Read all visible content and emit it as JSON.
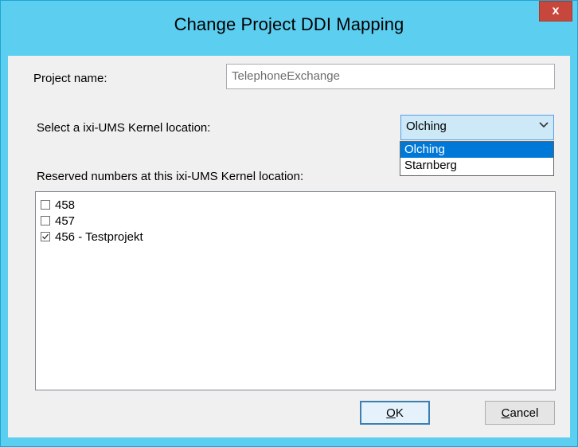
{
  "window": {
    "title": "Change Project DDI Mapping",
    "close_label": "x"
  },
  "form": {
    "project_name_label": "Project name:",
    "project_name_value": "TelephoneExchange",
    "location_label": "Select a ixi-UMS Kernel location:",
    "location_selected": "Olching",
    "location_options": [
      "Olching",
      "Starnberg"
    ],
    "reserved_label": "Reserved numbers at this ixi-UMS Kernel location:",
    "reserved_items": [
      {
        "label": "458",
        "checked": false
      },
      {
        "label": "457",
        "checked": false
      },
      {
        "label": "456 - Testprojekt",
        "checked": true
      }
    ]
  },
  "buttons": {
    "ok_first": "O",
    "ok_rest": "K",
    "cancel_first": "C",
    "cancel_rest": "ancel"
  },
  "colors": {
    "titlebar": "#5ccff0",
    "close": "#c7473c",
    "selection": "#0078d7"
  }
}
